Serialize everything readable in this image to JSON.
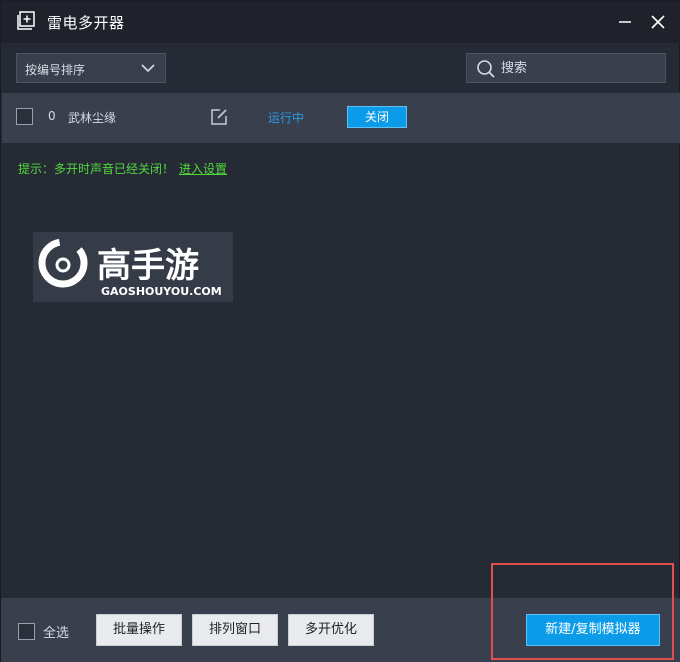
{
  "window": {
    "title": "雷电多开器"
  },
  "toolbar": {
    "sort_selected": "按编号排序",
    "search_placeholder": "搜索"
  },
  "instances": [
    {
      "index": "0",
      "name": "武林尘缘",
      "status": "运行中",
      "action_label": "关闭"
    }
  ],
  "hint": {
    "text": "提示：多开时声音已经关闭！",
    "link": "进入设置"
  },
  "watermark": {
    "brand": "高手游",
    "domain": "GAOSHOUYOU.COM"
  },
  "footer": {
    "select_all": "全选",
    "batch_label": "批量操作",
    "arrange_label": "排列窗口",
    "optimize_label": "多开优化",
    "new_copy_label": "新建/复制模拟器"
  },
  "colors": {
    "accent": "#0b9be8",
    "status_running": "#2a9be8",
    "hint_green": "#4fd93a",
    "highlight_frame": "#e05050"
  }
}
